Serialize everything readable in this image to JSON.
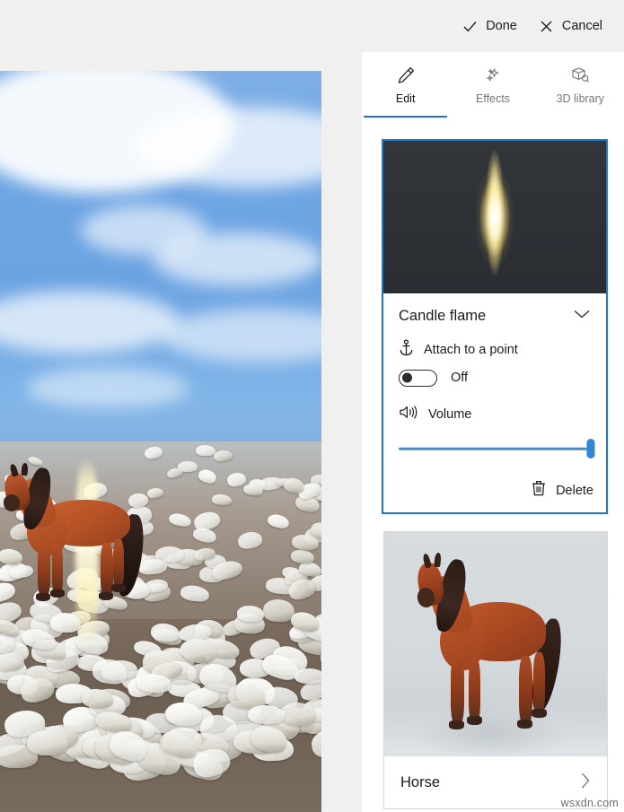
{
  "topbar": {
    "done_label": "Done",
    "done_icon": "checkmark-icon",
    "cancel_label": "Cancel",
    "cancel_icon": "close-icon"
  },
  "tabs": [
    {
      "label": "Edit",
      "icon": "pencil-icon",
      "active": true
    },
    {
      "label": "Effects",
      "icon": "sparkles-icon",
      "active": false
    },
    {
      "label": "3D library",
      "icon": "cube-search-icon",
      "active": false
    }
  ],
  "selected_object": {
    "title": "Candle flame",
    "thumbnail": "candle-flame-thumbnail",
    "collapse_icon": "chevron-down-icon",
    "attach": {
      "icon": "anchor-icon",
      "label": "Attach to a point",
      "state_label": "Off",
      "state_on": false
    },
    "volume": {
      "icon": "speaker-volume-icon",
      "label": "Volume",
      "value": 100,
      "min": 0,
      "max": 100
    },
    "delete": {
      "icon": "trash-icon",
      "label": "Delete"
    }
  },
  "other_object": {
    "title": "Horse",
    "thumbnail": "horse-3d-thumbnail",
    "expand_icon": "chevron-right-icon"
  },
  "stage": {
    "name": "video-preview-canvas",
    "description": "gannet-colony-with-3d-horse"
  },
  "watermark": "wsxdn.com",
  "colors": {
    "accent": "#1a7bc4",
    "slider": "#2f86d6",
    "panel_bg": "#ffffff",
    "app_bg": "#f0f0f0",
    "text": "#1b1b1b",
    "muted_text": "#767676"
  }
}
